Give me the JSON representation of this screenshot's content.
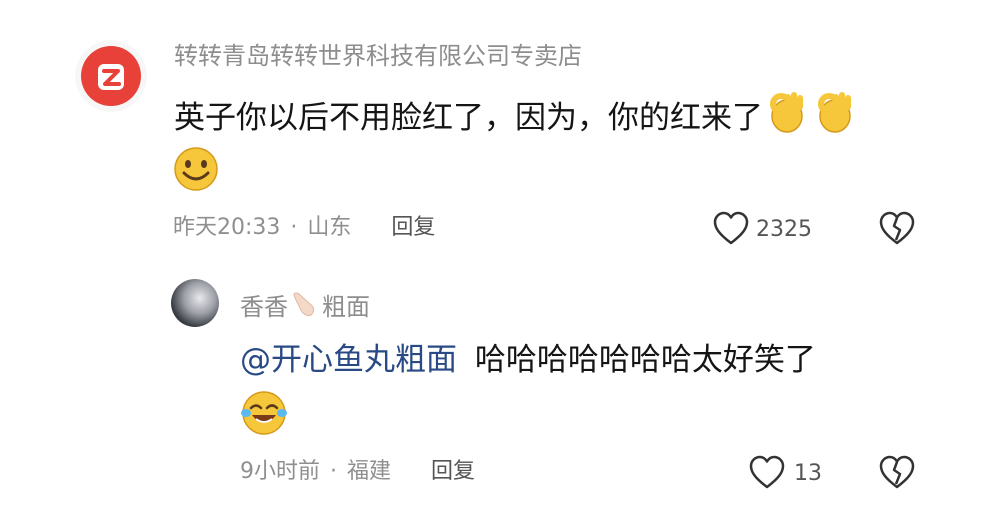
{
  "comments": [
    {
      "username": "转转青岛转转世界科技有限公司专卖店",
      "text": "英子你以后不用脸红了，因为，你的红来了",
      "time": "昨天20:33",
      "location": "山东",
      "reply_label": "回复",
      "likes": "2325",
      "emojis": [
        "ok-hand-emoji",
        "ok-hand-emoji",
        "smile-emoji"
      ]
    }
  ],
  "reply": {
    "username": "香香",
    "username_suffix": "粗面",
    "mention": "@开心鱼丸粗面",
    "text": "哈哈哈哈哈哈哈太好笑了",
    "time": "9小时前",
    "location": "福建",
    "reply_label": "回复",
    "likes": "13",
    "emojis": [
      "tears-of-joy-emoji"
    ]
  },
  "separator": "·",
  "colors": {
    "avatar_brand": "#e8413a",
    "mention": "#294a85",
    "muted_text": "#8d8d8d",
    "primary_text": "#151515",
    "emoji_yellow": "#f6c73a"
  }
}
